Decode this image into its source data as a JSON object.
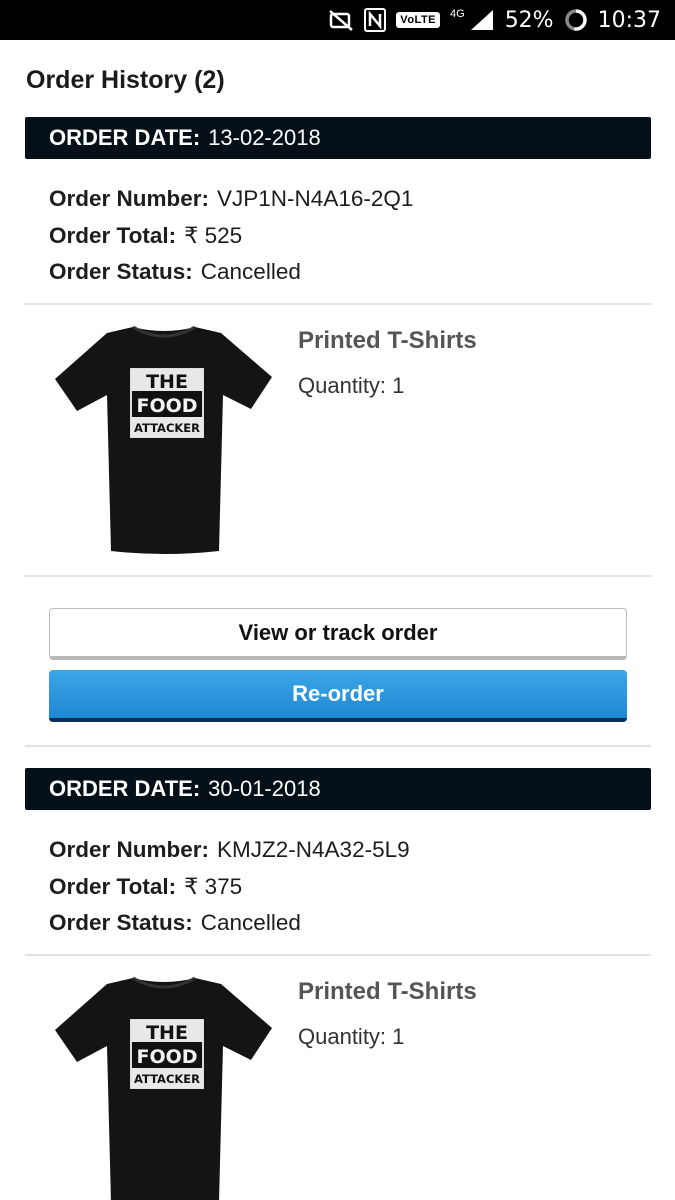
{
  "status_bar": {
    "battery": "52%",
    "time": "10:37",
    "volte": "VoLTE",
    "network": "4G",
    "icons": [
      "no-sim-icon",
      "nfc-icon",
      "volte-icon",
      "signal-icon",
      "battery-icon"
    ]
  },
  "page": {
    "title": "Order History (2)"
  },
  "labels": {
    "order_date": "ORDER DATE:",
    "order_number": "Order Number:",
    "order_total": "Order Total:",
    "order_status": "Order Status:",
    "quantity": "Quantity:",
    "view_track": "View or track order",
    "reorder": "Re-order"
  },
  "orders": [
    {
      "date": "13-02-2018",
      "number": "VJP1N-N4A16-2Q1",
      "total": "₹ 525",
      "status": "Cancelled",
      "item": {
        "name": "Printed T-Shirts",
        "quantity": "1",
        "print": [
          "THE",
          "FOOD",
          "ATTACKER"
        ]
      }
    },
    {
      "date": "30-01-2018",
      "number": "KMJZ2-N4A32-5L9",
      "total": "₹ 375",
      "status": "Cancelled",
      "item": {
        "name": "Printed T-Shirts",
        "quantity": "1",
        "print": [
          "THE",
          "FOOD",
          "ATTACKER"
        ]
      }
    }
  ],
  "colors": {
    "date_bar": "#061018",
    "reorder": "#2b98dc",
    "accent_dark": "#0b2e55"
  }
}
